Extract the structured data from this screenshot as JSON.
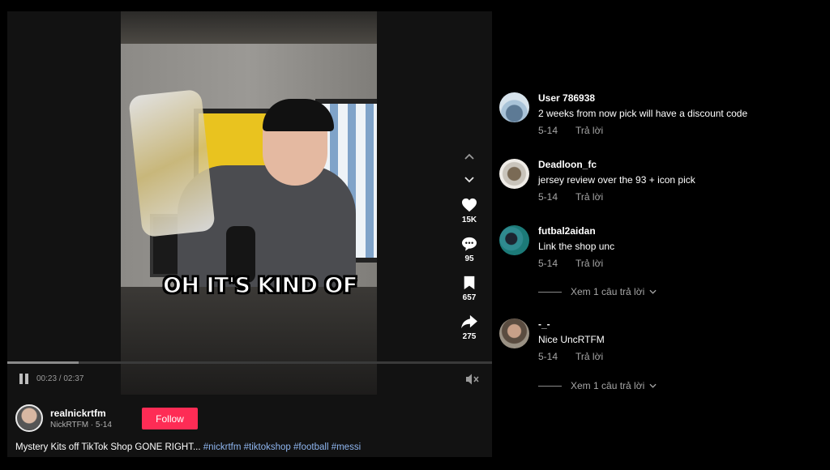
{
  "video": {
    "caption_overlay": "OH IT'S KIND OF",
    "likes": "15K",
    "comments": "95",
    "saves": "657",
    "shares": "275",
    "time_display": "00:23 / 02:37",
    "progress": 0.147
  },
  "author": {
    "username": "realnickrtfm",
    "subline": "NickRTFM · 5-14",
    "follow_label": "Follow",
    "description_text": "Mystery Kits off TikTok Shop GONE RIGHT... ",
    "hashtags": [
      "#nickrtfm",
      "#tiktokshop",
      "#football",
      "#messi"
    ]
  },
  "comments": [
    {
      "user": "User 786938",
      "text": "2 weeks from now pick will have a discount code",
      "date": "5-14",
      "reply_label": "Trả lời"
    },
    {
      "user": "Deadloon_fc",
      "text": "jersey review over the 93 + icon pick",
      "date": "5-14",
      "reply_label": "Trả lời"
    },
    {
      "user": "futbal2aidan",
      "text": "Link the shop unc",
      "date": "5-14",
      "reply_label": "Trả lời",
      "view_replies": "Xem 1 câu trả lời"
    },
    {
      "user": "-_-",
      "text": "Nice UncRTFM",
      "date": "5-14",
      "reply_label": "Trả lời",
      "view_replies": "Xem 1 câu trả lời"
    }
  ],
  "colors": {
    "accent": "#fe2c55",
    "hashtag": "#8fb6f0",
    "muted": "#a7a7a7"
  },
  "icons": [
    "pause-icon",
    "mute-icon",
    "chevron-up-icon",
    "chevron-down-icon",
    "heart-icon",
    "comment-icon",
    "bookmark-icon",
    "share-icon"
  ]
}
